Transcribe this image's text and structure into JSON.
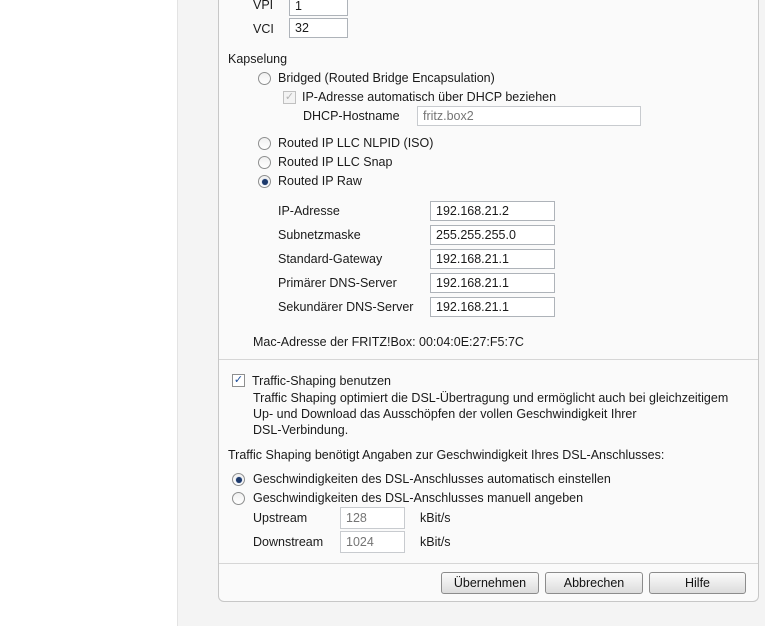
{
  "atm": {
    "vpi_label": "VPI",
    "vpi_value": "1",
    "vci_label": "VCI",
    "vci_value": "32"
  },
  "encapsulation": {
    "heading": "Kapselung",
    "bridged_label": "Bridged (Routed Bridge Encapsulation)",
    "dhcp_checkbox_label": "IP-Adresse automatisch über DHCP beziehen",
    "dhcp_hostname_label": "DHCP-Hostname",
    "dhcp_hostname_placeholder": "fritz.box2",
    "llc_nlpid_label": "Routed IP LLC NLPID (ISO)",
    "llc_snap_label": "Routed IP LLC Snap",
    "ip_raw_label": "Routed IP Raw",
    "selected": "Routed IP Raw"
  },
  "ip_settings": {
    "ip_label": "IP-Adresse",
    "ip_value": "192.168.21.2",
    "mask_label": "Subnetzmaske",
    "mask_value": "255.255.255.0",
    "gateway_label": "Standard-Gateway",
    "gateway_value": "192.168.21.1",
    "dns1_label": "Primärer DNS-Server",
    "dns1_value": "192.168.21.1",
    "dns2_label": "Sekundärer DNS-Server",
    "dns2_value": "192.168.21.1"
  },
  "mac_text": "Mac-Adresse der FRITZ!Box: 00:04:0E:27:F5:7C",
  "traffic": {
    "checkbox_label": "Traffic-Shaping benutzen",
    "desc_line1": "Traffic Shaping optimiert die DSL-Übertragung und ermöglicht auch bei gleichzeitigem",
    "desc_line2": "Up- und Download das Ausschöpfen der vollen Geschwindigkeit Ihrer",
    "desc_line3": "DSL-Verbindung.",
    "speed_intro": "Traffic Shaping benötigt Angaben zur Geschwindigkeit Ihres DSL-Anschlusses:",
    "auto_label": "Geschwindigkeiten des DSL-Anschlusses automatisch einstellen",
    "manual_label": "Geschwindigkeiten des DSL-Anschlusses manuell angeben",
    "upstream_label": "Upstream",
    "upstream_placeholder": "128",
    "upstream_unit": "kBit/s",
    "downstream_label": "Downstream",
    "downstream_placeholder": "1024",
    "downstream_unit": "kBit/s"
  },
  "buttons": {
    "apply": "Übernehmen",
    "cancel": "Abbrechen",
    "help": "Hilfe"
  },
  "colors": {
    "radio_dot": "#1d3a6b",
    "check_mark": "#1d4e9a",
    "panel_bg": "#fafafa"
  }
}
